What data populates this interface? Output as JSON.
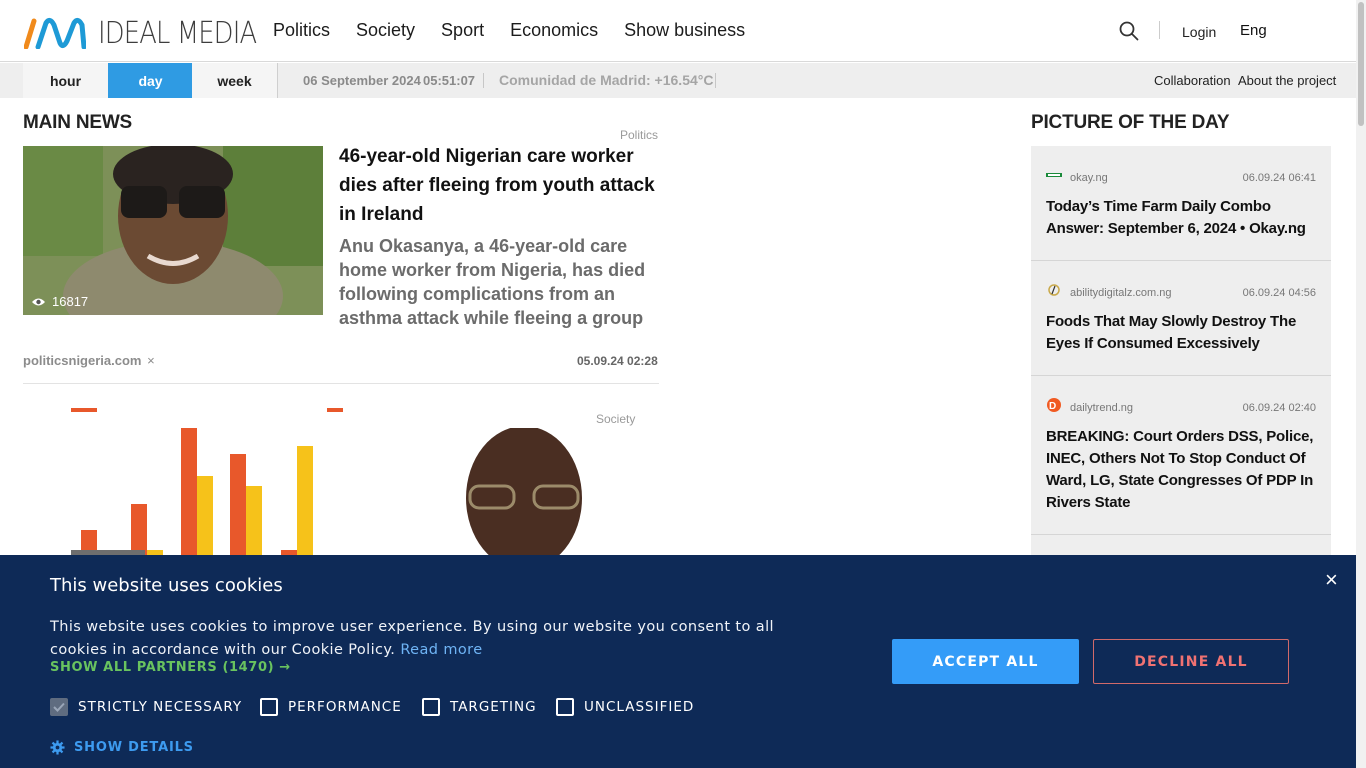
{
  "header": {
    "logo_text": "IDEAL MEDIA",
    "nav": [
      "Politics",
      "Society",
      "Sport",
      "Economics",
      "Show business"
    ],
    "login": "Login",
    "language": "Eng"
  },
  "subbar": {
    "periods": [
      "hour",
      "day",
      "week"
    ],
    "active_period": "day",
    "date": "06 September 2024",
    "time": "05:51:07",
    "weather": "Comunidad de Madrid: +16.54°C",
    "links": [
      "Collaboration",
      "About the project"
    ]
  },
  "main_news": {
    "title": "MAIN NEWS",
    "article": {
      "category": "Politics",
      "views": "16817",
      "headline": "46-year-old Nigerian care worker dies after fleeing from youth attack in Ireland",
      "lead": "Anu Okasanya, a 46-year-old care home worker from Nigeria, has died following complications from an asthma attack while fleeing a group of youths in Newry,",
      "source": "politicsnigeria.com",
      "source_remove": "×",
      "date": "05.09.24 02:28"
    },
    "article2": {
      "category": "Society"
    }
  },
  "picture_of_day": {
    "title": "PICTURE OF THE DAY",
    "items": [
      {
        "source": "okay.ng",
        "date": "06.09.24 06:41",
        "title": "Today’s Time Farm Daily Combo Answer: September 6, 2024 • Okay.ng",
        "icon": "okay-ng-icon"
      },
      {
        "source": "abilitydigitalz.com.ng",
        "date": "06.09.24 04:56",
        "title": "Foods That May Slowly Destroy The Eyes If Consumed Excessively",
        "icon": "abilitydigitalz-icon"
      },
      {
        "source": "dailytrend.ng",
        "date": "06.09.24 02:40",
        "title": "BREAKING: Court Orders DSS, Police, INEC, Others Not To Stop Conduct Of Ward, LG, State Congresses Of PDP In Rivers State",
        "icon": "dailytrend-icon"
      }
    ]
  },
  "cookie": {
    "title": "This website uses cookies",
    "text": "This website uses cookies to improve user experience. By using our website you consent to all cookies in accordance with our Cookie Policy.",
    "read_more": "Read more",
    "partners": "SHOW ALL PARTNERS (1470) →",
    "checkboxes": [
      {
        "label": "STRICTLY NECESSARY",
        "checked": true
      },
      {
        "label": "PERFORMANCE",
        "checked": false
      },
      {
        "label": "TARGETING",
        "checked": false
      },
      {
        "label": "UNCLASSIFIED",
        "checked": false
      }
    ],
    "show_details": "SHOW DETAILS",
    "accept": "ACCEPT ALL",
    "decline": "DECLINE ALL",
    "close": "×"
  },
  "colors": {
    "accent": "#2f9be3",
    "cookie_bg": "#0e2a57",
    "accept_btn": "#349cf8",
    "decline_text": "#f07272",
    "partners_green": "#69c35f"
  }
}
